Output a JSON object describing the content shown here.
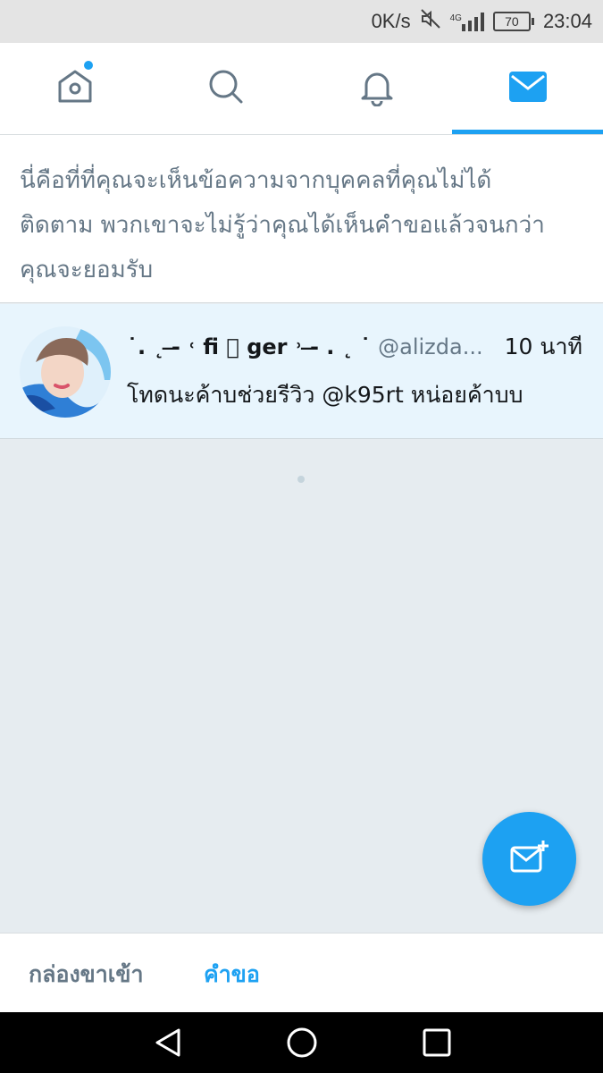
{
  "status_bar": {
    "net_speed": "0K/s",
    "network_type": "4G",
    "battery": "70",
    "time": "23:04"
  },
  "tabs": [
    {
      "name": "home",
      "icon": "home-icon",
      "active": false,
      "has_dot": true
    },
    {
      "name": "search",
      "icon": "search-icon",
      "active": false
    },
    {
      "name": "notifications",
      "icon": "bell-icon",
      "active": false
    },
    {
      "name": "messages",
      "icon": "envelope-icon",
      "active": true
    }
  ],
  "info": {
    "text_line1": "นี่คือที่ที่คุณจะเห็นข้อความจากบุคคลที่คุณไม่ได้",
    "text_line2": "ติดตาม พวกเขาจะไม่รู้ว่าคุณได้เห็นคำขอแล้วจนกว่า",
    "text_line3": "คุณจะยอมรับ"
  },
  "message": {
    "display_name": "˙. ˛ ‑̶ ˓ fi ⃣ ger ˒ ‑̶ . ˛ ˙",
    "handle": "@alizda...",
    "time": "10 นาที",
    "text": "โทดนะค้าบช่วยรีวิว @k95rt หน่อยค้าบบ"
  },
  "bottom_tabs": {
    "inbox": "กล่องขาเข้า",
    "requests": "คำขอ"
  },
  "colors": {
    "accent": "#1da1f2",
    "text_secondary": "#657786",
    "background": "#e6ecf0",
    "highlight_row": "#e8f5fd"
  }
}
